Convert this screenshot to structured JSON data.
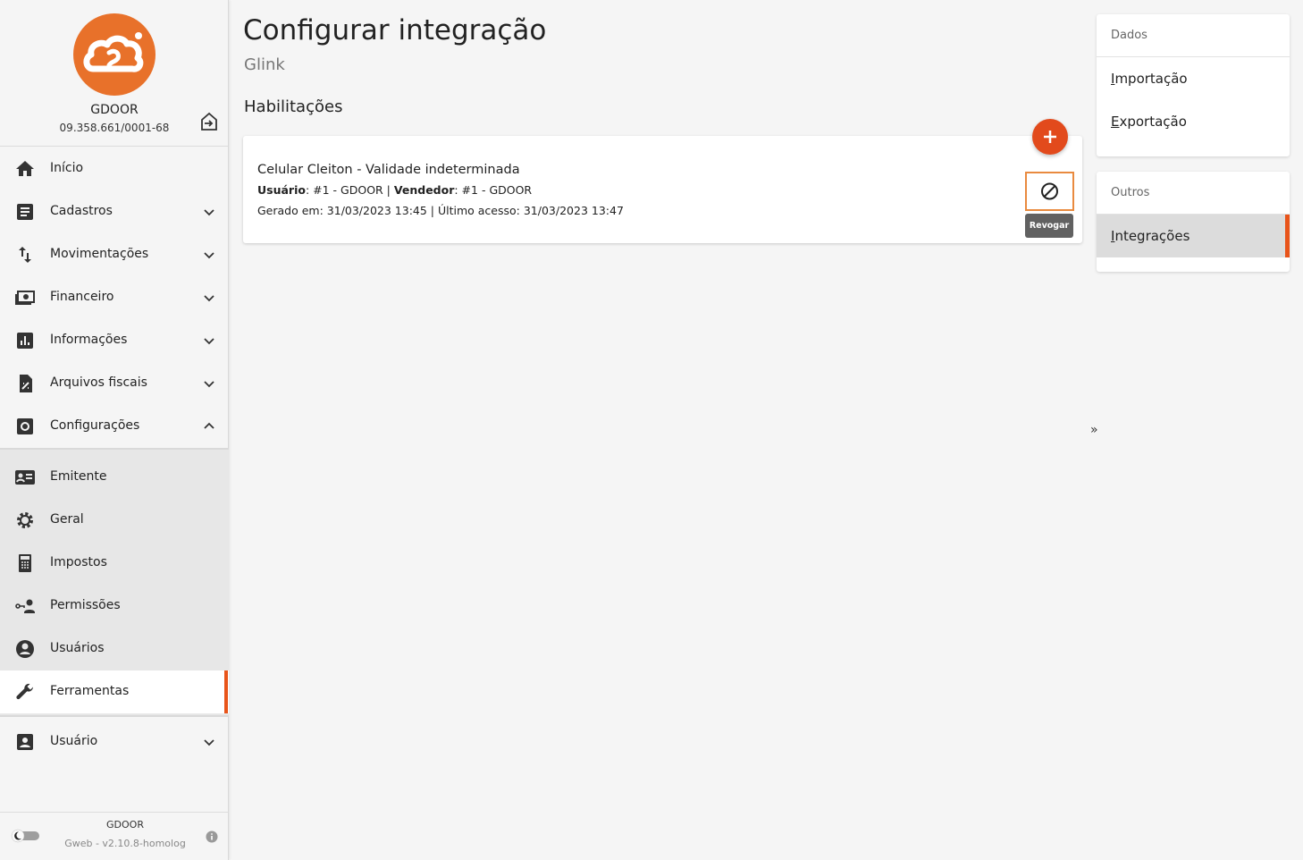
{
  "company": {
    "name": "GDOOR",
    "cnpj": "09.358.661/0001-68"
  },
  "nav": {
    "items": [
      {
        "label": "Início",
        "icon": "home-icon"
      },
      {
        "label": "Cadastros",
        "icon": "document-icon"
      },
      {
        "label": "Movimentações",
        "icon": "swap-vertical-icon"
      },
      {
        "label": "Financeiro",
        "icon": "money-icon"
      },
      {
        "label": "Informações",
        "icon": "bar-chart-icon"
      },
      {
        "label": "Arquivos fiscais",
        "icon": "tax-file-icon"
      },
      {
        "label": "Configurações",
        "icon": "settings-box-icon"
      }
    ],
    "sub_items": [
      {
        "label": "Emitente",
        "icon": "id-card-icon"
      },
      {
        "label": "Geral",
        "icon": "gear-icon"
      },
      {
        "label": "Impostos",
        "icon": "calculator-icon"
      },
      {
        "label": "Permissões",
        "icon": "key-user-icon"
      },
      {
        "label": "Usuários",
        "icon": "account-circle-icon"
      },
      {
        "label": "Ferramentas",
        "icon": "wrench-icon",
        "active": true
      }
    ],
    "user": {
      "label": "Usuário",
      "icon": "account-box-icon"
    }
  },
  "footer": {
    "company": "GDOOR",
    "version": "Gweb - v2.10.8-homolog"
  },
  "page": {
    "title": "Configurar integração",
    "subtitle": "Glink",
    "section": "Habilitações"
  },
  "card": {
    "title": "Celular Cleiton - Validade indeterminada",
    "user_label": "Usuário",
    "user_value": ": #1 - GDOOR | ",
    "seller_label": "Vendedor",
    "seller_value": ": #1 - GDOOR",
    "generated_line": "Gerado em: 31/03/2023 13:45 | Último acesso: 31/03/2023 13:47",
    "revoke_tooltip": "Revogar"
  },
  "right_panel": {
    "data_header": "Dados",
    "data_items": [
      {
        "first": "I",
        "rest": "mportação"
      },
      {
        "first": "E",
        "rest": "xportação"
      }
    ],
    "other_header": "Outros",
    "other_items": [
      {
        "first": "I",
        "rest": "ntegrações",
        "active": true
      }
    ],
    "collapse_label": "»"
  },
  "colors": {
    "accent": "#e8541a",
    "fab": "#e24a1c",
    "logo": "#e8712a",
    "focus_outline": "#e98a3f"
  }
}
